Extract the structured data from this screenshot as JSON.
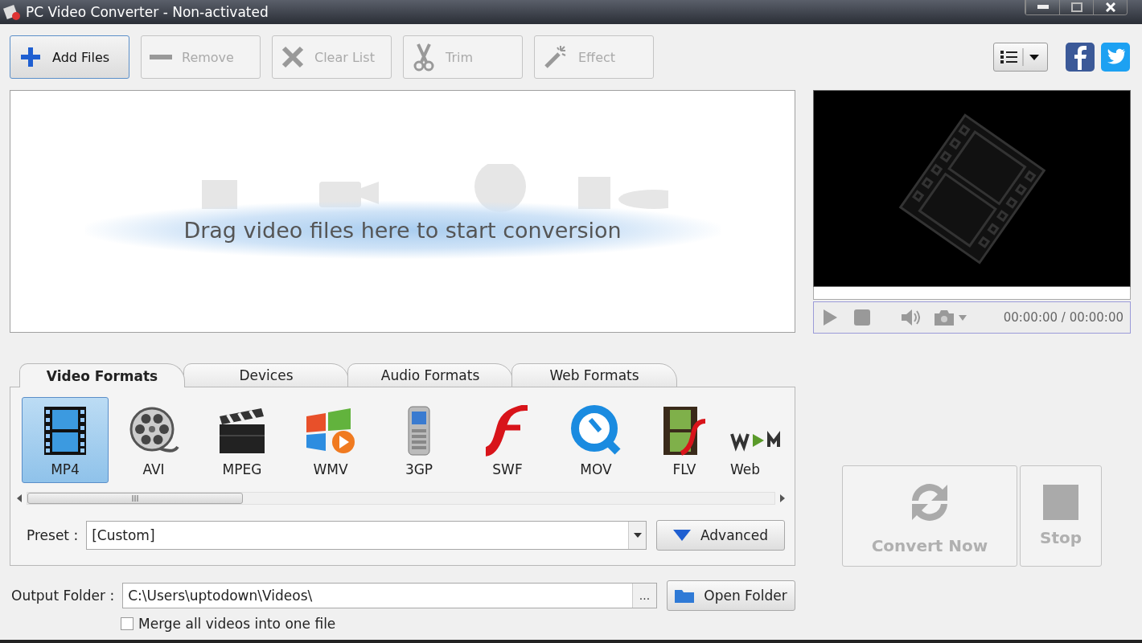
{
  "window": {
    "title": "PC Video Converter - Non-activated"
  },
  "toolbar": [
    {
      "label": "Add Files",
      "disabled": false
    },
    {
      "label": "Remove",
      "disabled": true
    },
    {
      "label": "Clear List",
      "disabled": true
    },
    {
      "label": "Trim",
      "disabled": true
    },
    {
      "label": "Effect",
      "disabled": true
    }
  ],
  "drop_zone": {
    "text": "Drag video files here to start conversion"
  },
  "player": {
    "time": "00:00:00 / 00:00:00"
  },
  "tabs": [
    {
      "label": "Video Formats",
      "selected": true
    },
    {
      "label": "Devices",
      "selected": false
    },
    {
      "label": "Audio Formats",
      "selected": false
    },
    {
      "label": "Web Formats",
      "selected": false
    }
  ],
  "formats": [
    {
      "label": "MP4",
      "selected": true
    },
    {
      "label": "AVI",
      "selected": false
    },
    {
      "label": "MPEG",
      "selected": false
    },
    {
      "label": "WMV",
      "selected": false
    },
    {
      "label": "3GP",
      "selected": false
    },
    {
      "label": "SWF",
      "selected": false
    },
    {
      "label": "MOV",
      "selected": false
    },
    {
      "label": "FLV",
      "selected": false
    },
    {
      "label": "Web",
      "selected": false
    }
  ],
  "preset": {
    "label": "Preset :",
    "value": "[Custom]",
    "advanced_button": "Advanced"
  },
  "output": {
    "label": "Output Folder :",
    "value": "C:\\Users\\uptodown\\Videos\\",
    "browse_button": "...",
    "open_button": "Open Folder"
  },
  "merge": {
    "label": "Merge all videos into one file",
    "checked": false
  },
  "actions": [
    {
      "label": "Convert Now",
      "disabled": true
    },
    {
      "label": "Stop",
      "disabled": true
    }
  ]
}
